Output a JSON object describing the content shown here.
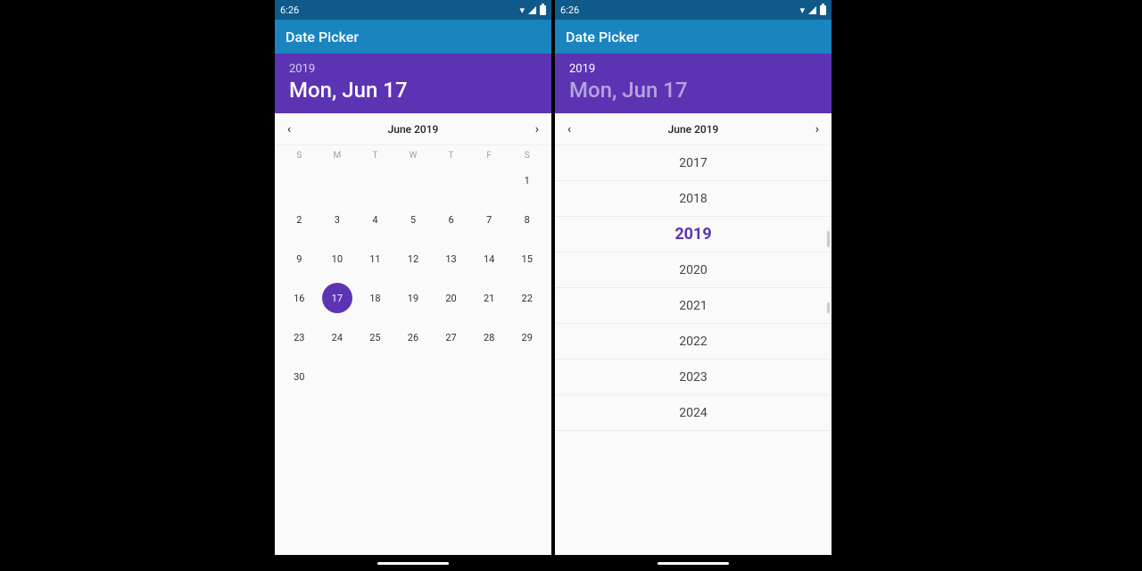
{
  "status": {
    "time": "6:26"
  },
  "appbar": {
    "title": "Date Picker"
  },
  "header": {
    "year": "2019",
    "date": "Mon, Jun 17"
  },
  "monthnav": {
    "label": "June 2019"
  },
  "dow": [
    "S",
    "M",
    "T",
    "W",
    "T",
    "F",
    "S"
  ],
  "calendar": {
    "start_day_index": 6,
    "days_in_month": 30,
    "selected_day": 17
  },
  "year_picker": {
    "years": [
      2017,
      2018,
      2019,
      2020,
      2021,
      2022,
      2023,
      2024
    ],
    "selected": 2019
  }
}
